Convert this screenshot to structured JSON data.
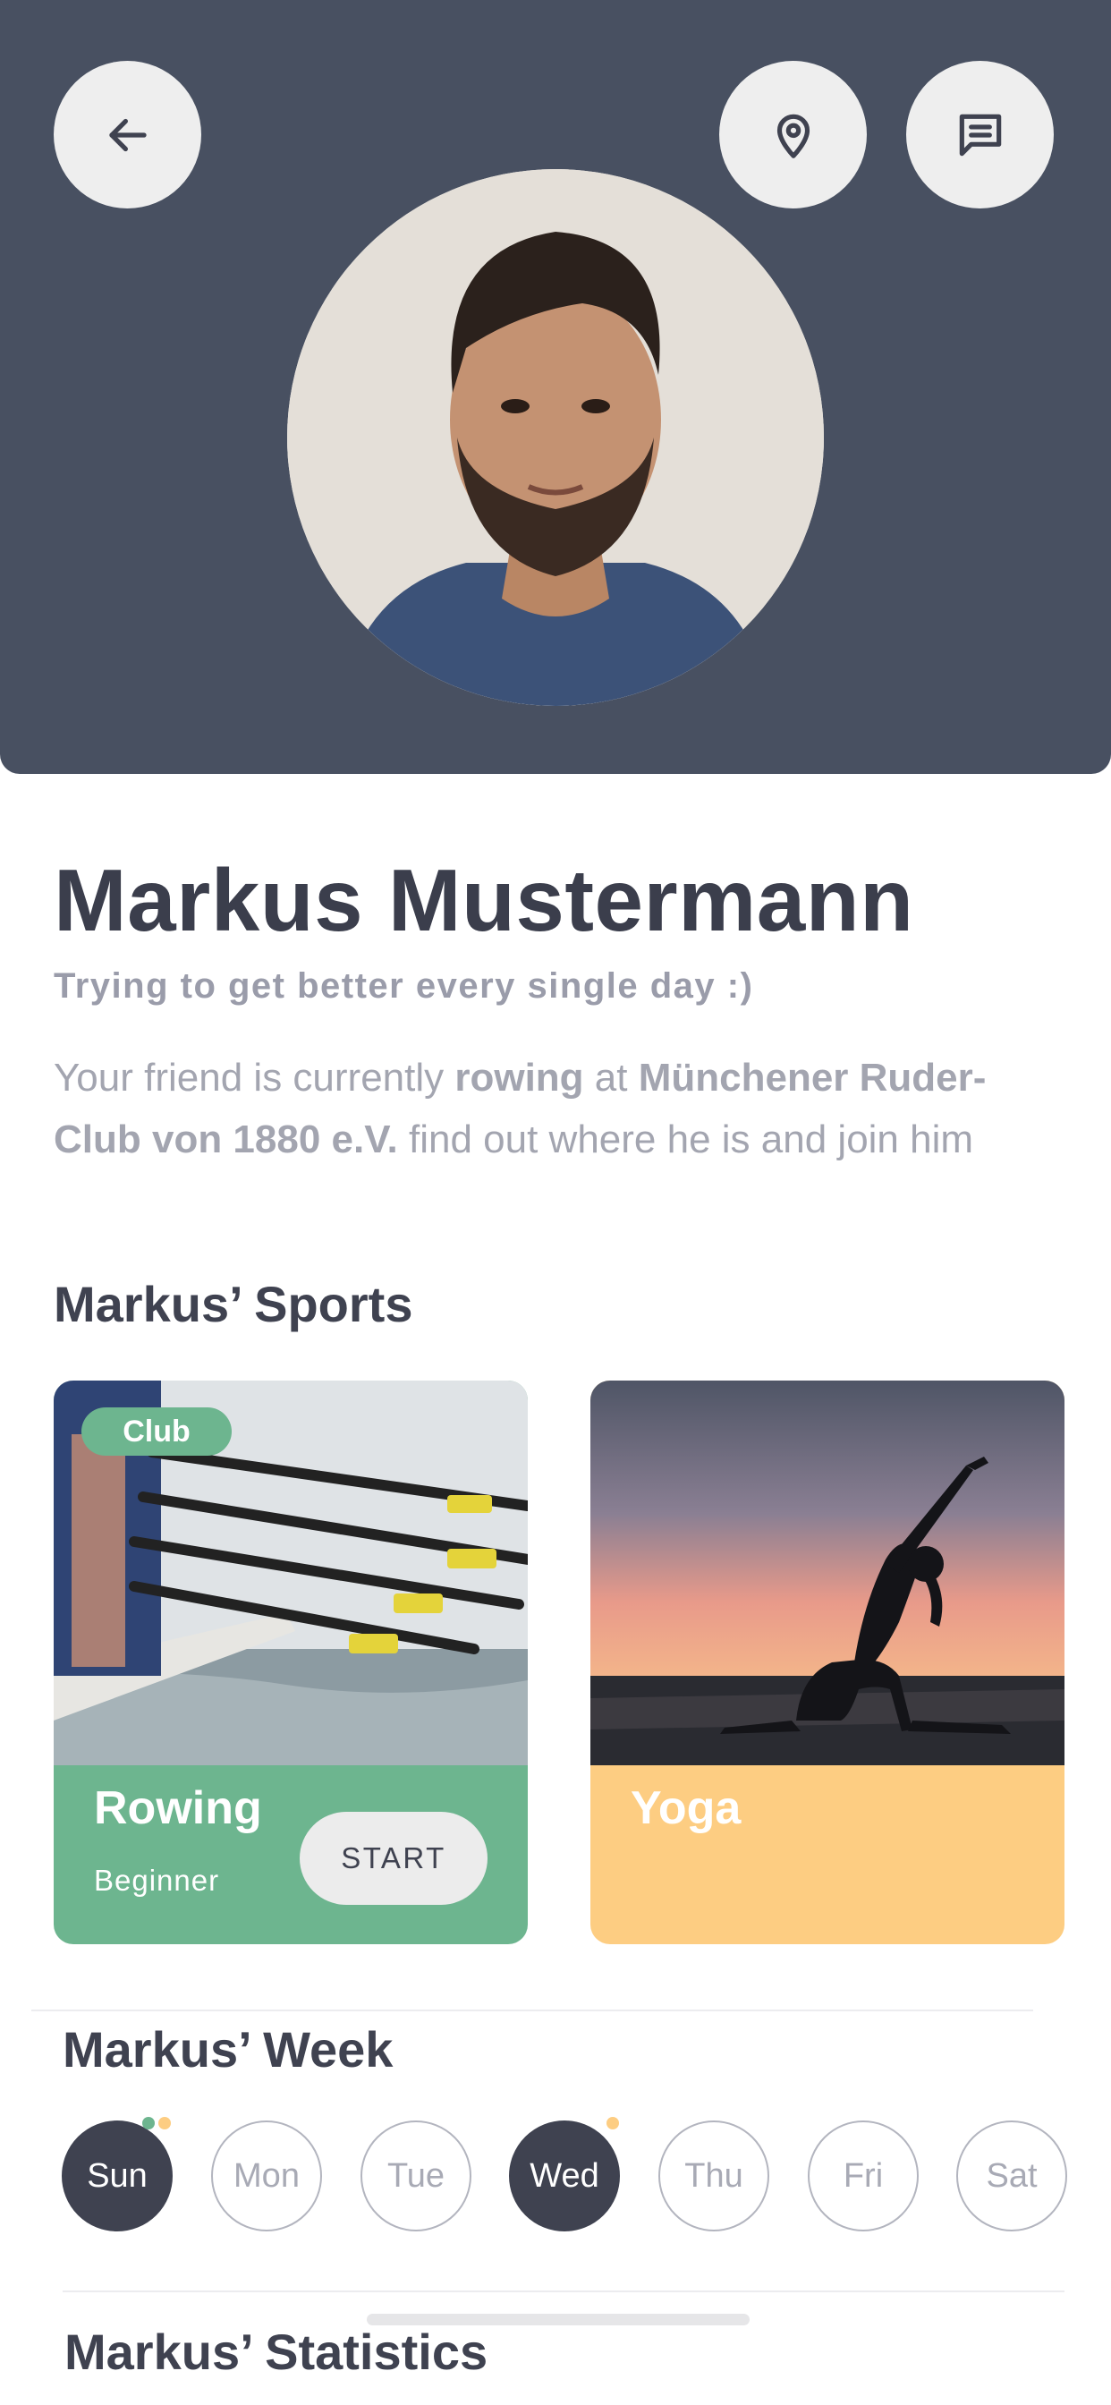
{
  "header": {
    "back_icon": "arrow-left-icon",
    "location_icon": "map-pin-icon",
    "chat_icon": "chat-message-icon",
    "bg_color": "#485061"
  },
  "profile": {
    "name": "Markus Mustermann",
    "tagline": "Trying to get better every single day :)",
    "status": {
      "prefix": "Your friend is currently ",
      "activity": "rowing",
      "mid": " at ",
      "location": "Münchener Ruder-Club von 1880 e.V.",
      "suffix": "  find out where he is and join him"
    }
  },
  "sports": {
    "title": "Markus’ Sports",
    "cards": [
      {
        "name": "Rowing",
        "level": "Beginner",
        "badge": "Club",
        "action": "START",
        "color": "#6db58f"
      },
      {
        "name": "Yoga",
        "color": "#fdcd82"
      }
    ]
  },
  "week": {
    "title": "Markus’ Week",
    "days": [
      "Sun",
      "Mon",
      "Tue",
      "Wed",
      "Thu",
      "Fri",
      "Sat"
    ],
    "active_days": [
      "Sun",
      "Wed"
    ],
    "indicator_colors": {
      "green": "#6db58f",
      "orange": "#fdcd82"
    }
  },
  "statistics": {
    "title": "Markus’ Statistics"
  }
}
